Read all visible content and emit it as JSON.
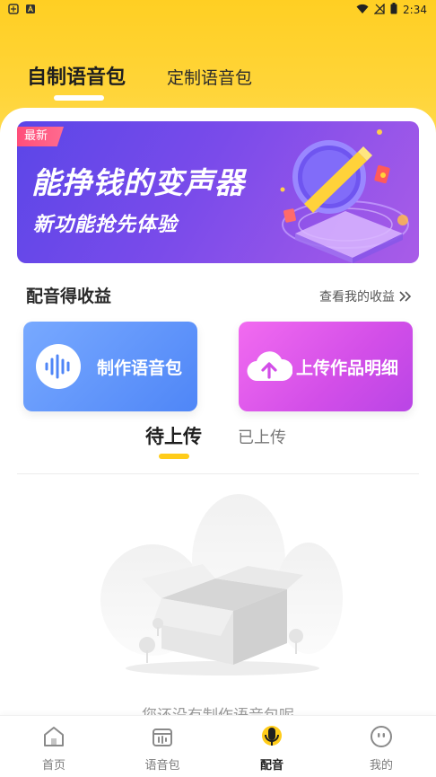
{
  "status_bar": {
    "time": "2:34",
    "left_icons": [
      "app-icon",
      "a-icon"
    ],
    "right_icons": [
      "wifi-icon",
      "signal-icon",
      "battery-icon"
    ]
  },
  "top_tabs": {
    "self_made": "自制语音包",
    "custom": "定制语音包"
  },
  "banner": {
    "badge": "最新",
    "title": "能挣钱的变声器",
    "subtitle": "新功能抢先体验"
  },
  "earnings": {
    "title": "配音得收益",
    "link": "查看我的收益",
    "link_icon": "double-chevron-right-icon"
  },
  "actions": {
    "make": {
      "label": "制作语音包",
      "icon": "waveform-icon"
    },
    "upload": {
      "label": "上传作品明细",
      "icon": "cloud-upload-icon"
    }
  },
  "upload_tabs": {
    "pending": "待上传",
    "done": "已上传"
  },
  "empty_state": {
    "text": "您还没有制作语音包呢"
  },
  "bottom_nav": [
    {
      "label": "首页",
      "icon": "home-icon",
      "active": false
    },
    {
      "label": "语音包",
      "icon": "package-icon",
      "active": false
    },
    {
      "label": "配音",
      "icon": "microphone-icon",
      "active": true
    },
    {
      "label": "我的",
      "icon": "profile-icon",
      "active": false
    }
  ],
  "colors": {
    "accent_yellow": "#ffcc1a",
    "banner_purple": "#6a4ae9",
    "make_blue": "#4f86f7",
    "upload_magenta": "#d24ee8"
  }
}
